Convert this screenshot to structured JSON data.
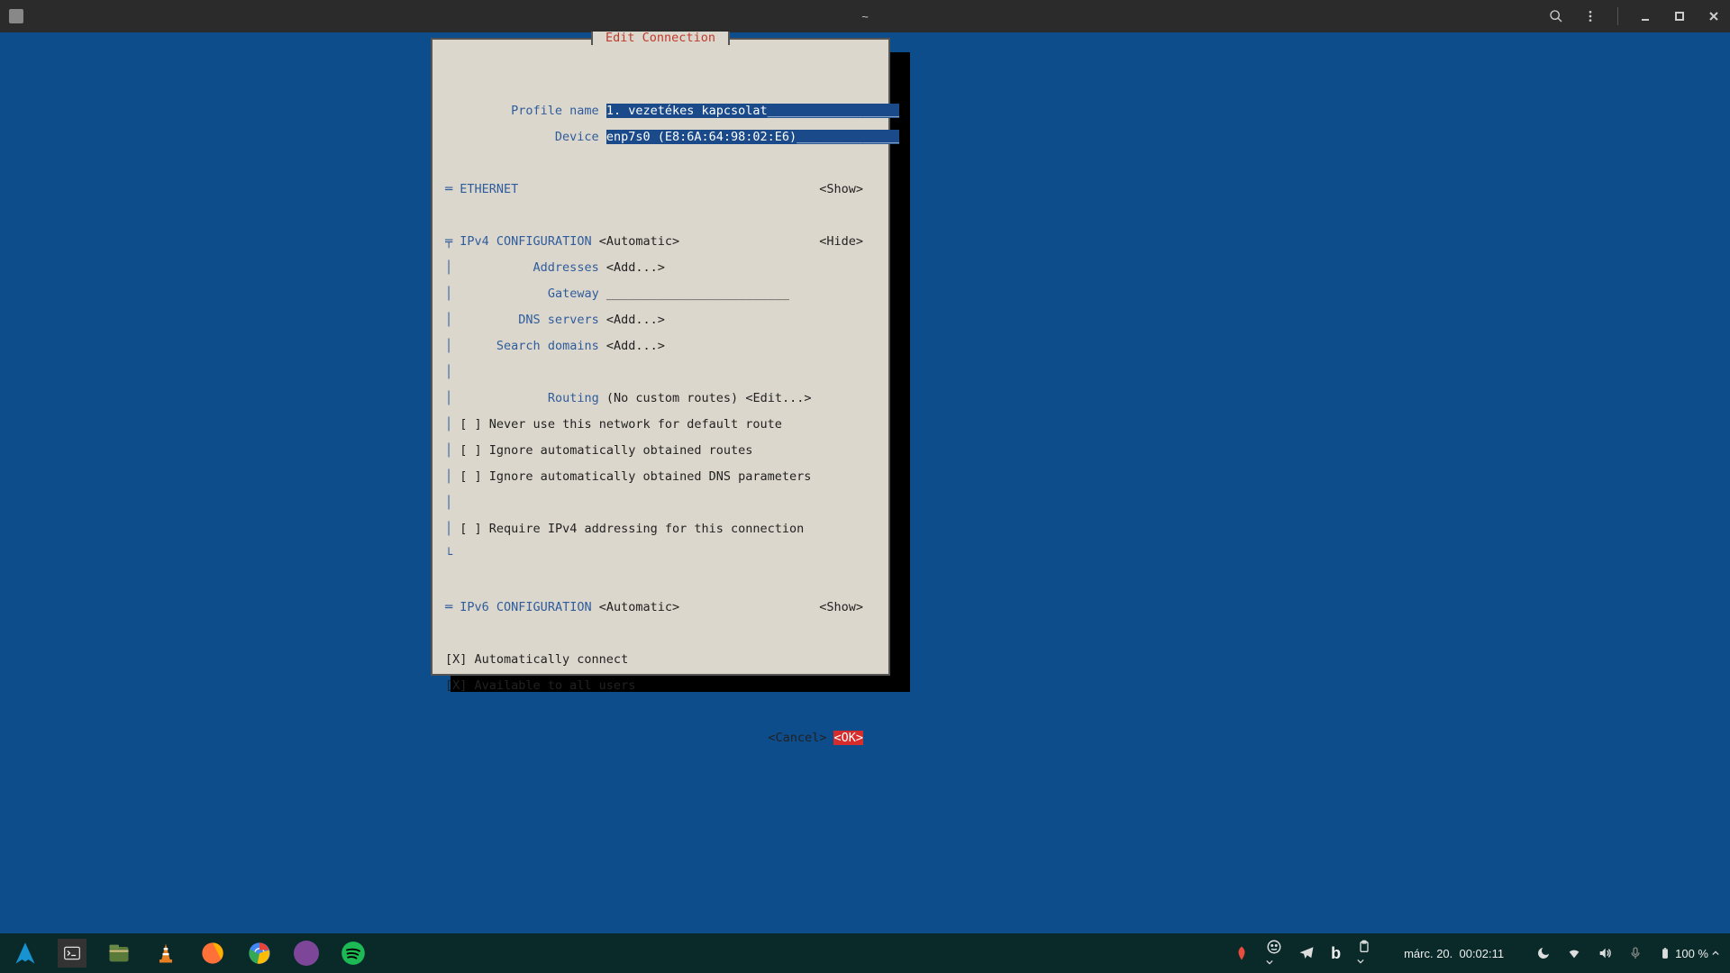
{
  "titlebar": {
    "title": "~",
    "search_icon": "search",
    "menu_icon": "menu"
  },
  "dialog": {
    "title": " Edit Connection ",
    "profile_name_label": "Profile name",
    "profile_name_value": "1. vezetékes kapcsolat__________________",
    "device_label": "Device",
    "device_value": "enp7s0 (E8:6A:64:98:02:E6)______________",
    "ethernet": {
      "label": "ETHERNET",
      "toggle": "<Show>"
    },
    "ipv4": {
      "label": "IPv4 CONFIGURATION",
      "mode": "<Automatic>",
      "toggle": "<Hide>",
      "addresses_label": "Addresses",
      "addresses_action": "<Add...>",
      "gateway_label": "Gateway",
      "gateway_value": "_________________________",
      "dns_label": "DNS servers",
      "dns_action": "<Add...>",
      "search_label": "Search domains",
      "search_action": "<Add...>",
      "routing_label": "Routing",
      "routing_value": "(No custom routes)",
      "routing_action": "<Edit...>",
      "checkbox_never_default": "[ ] Never use this network for default route",
      "checkbox_ignore_routes": "[ ] Ignore automatically obtained routes",
      "checkbox_ignore_dns": "[ ] Ignore automatically obtained DNS parameters",
      "checkbox_require_ipv4": "[ ] Require IPv4 addressing for this connection"
    },
    "ipv6": {
      "label": "IPv6 CONFIGURATION",
      "mode": "<Automatic>",
      "toggle": "<Show>"
    },
    "auto_connect": "[X] Automatically connect",
    "all_users": "[X] Available to all users",
    "cancel": "<Cancel>",
    "ok": "<OK>"
  },
  "taskbar": {
    "datetime": "márc. 20.  00:02:11",
    "battery": "100 %"
  }
}
